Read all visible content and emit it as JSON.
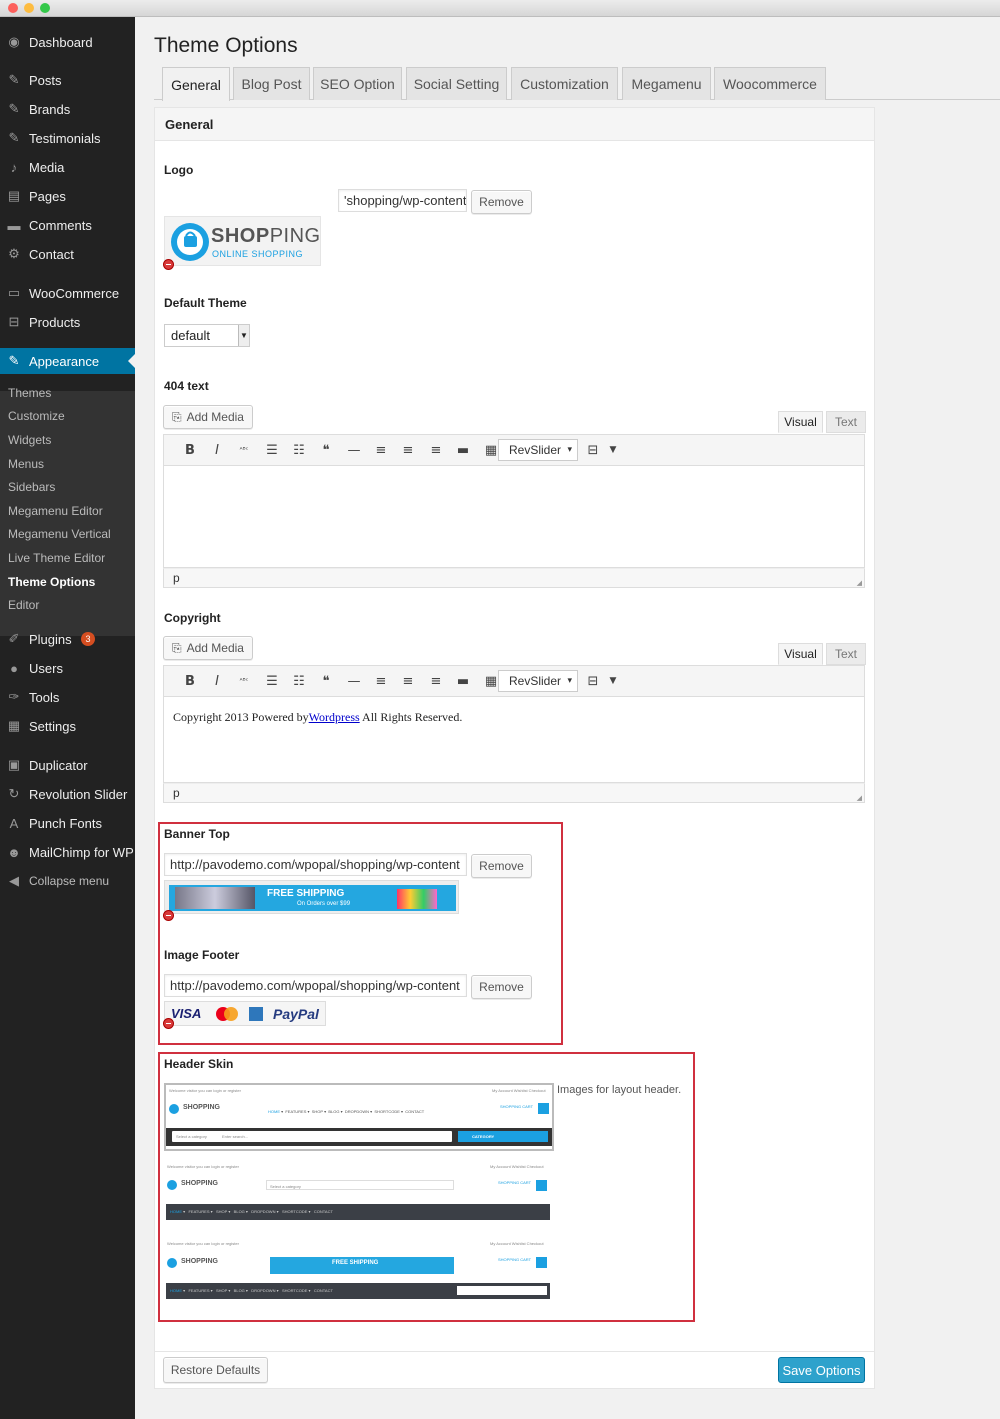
{
  "window": {
    "dot_colors": [
      "#fc605c",
      "#fdbc40",
      "#34c84a"
    ]
  },
  "sidebar": {
    "items": [
      {
        "label": "Dashboard",
        "icon": "dashboard-icon"
      },
      {
        "label": "Posts",
        "icon": "pin-icon"
      },
      {
        "label": "Brands",
        "icon": "pin-icon"
      },
      {
        "label": "Testimonials",
        "icon": "pin-icon"
      },
      {
        "label": "Media",
        "icon": "media-icon"
      },
      {
        "label": "Pages",
        "icon": "pages-icon"
      },
      {
        "label": "Comments",
        "icon": "comments-icon"
      },
      {
        "label": "Contact",
        "icon": "gear-icon"
      },
      {
        "label": "WooCommerce",
        "icon": "woo-icon"
      },
      {
        "label": "Products",
        "icon": "cart-icon"
      },
      {
        "label": "Appearance",
        "icon": "brush-icon"
      },
      {
        "label": "Plugins",
        "icon": "plug-icon",
        "badge": "3"
      },
      {
        "label": "Users",
        "icon": "user-icon"
      },
      {
        "label": "Tools",
        "icon": "wrench-icon"
      },
      {
        "label": "Settings",
        "icon": "settings-icon"
      },
      {
        "label": "Duplicator",
        "icon": "duplicator-icon"
      },
      {
        "label": "Revolution Slider",
        "icon": "refresh-icon"
      },
      {
        "label": "Punch Fonts",
        "icon": "font-icon"
      },
      {
        "label": "MailChimp for WP",
        "icon": "mailchimp-icon"
      },
      {
        "label": "Collapse menu",
        "icon": "collapse-icon"
      }
    ],
    "submenu": [
      "Themes",
      "Customize",
      "Widgets",
      "Menus",
      "Sidebars",
      "Megamenu Editor",
      "Megamenu Vertical",
      "Live Theme Editor",
      "Theme Options",
      "Editor"
    ]
  },
  "page": {
    "title": "Theme Options"
  },
  "tabs": [
    "General",
    "Blog Post",
    "SEO Option",
    "Social Setting",
    "Customization",
    "Megamenu",
    "Woocommerce"
  ],
  "panel": {
    "title": "General"
  },
  "logo": {
    "label": "Logo",
    "url": "'shopping/wp-content",
    "remove": "Remove",
    "brand_a": "SHOP",
    "brand_b": "PING",
    "tagline": "ONLINE SHOPPING"
  },
  "default_theme": {
    "label": "Default Theme",
    "value": "default"
  },
  "text404": {
    "label": "404 text",
    "add_media": "Add Media",
    "visual": "Visual",
    "text": "Text",
    "revslider": "RevSlider",
    "path": "p"
  },
  "copyright": {
    "label": "Copyright",
    "add_media": "Add Media",
    "visual": "Visual",
    "text": "Text",
    "revslider": "RevSlider",
    "content_before": "Copyright 2013 Powered by",
    "link": "Wordpress",
    "content_after": " All Rights Reserved.",
    "path": "p"
  },
  "banner_top": {
    "label": "Banner Top",
    "url": "http://pavodemo.com/wpopal/shopping/wp-content",
    "remove": "Remove",
    "headline": "FREE SHIPPING",
    "subline": "On Orders over $99"
  },
  "image_footer": {
    "label": "Image Footer",
    "url": "http://pavodemo.com/wpopal/shopping/wp-content",
    "remove": "Remove",
    "cards": [
      "VISA",
      "MasterCard",
      "AmEx",
      "PayPal"
    ]
  },
  "header_skin": {
    "label": "Header Skin",
    "description": "Images for layout header.",
    "welcome": "Welcome visitor you can login or register",
    "account": "My Account  Wishlist  Checkout",
    "nav": [
      "HOME",
      "FEATURES",
      "SHOP",
      "BLOG",
      "DROPDOWN",
      "SHORTCODE",
      "CONTACT"
    ],
    "cart": "SHOPPING CART",
    "cart_sub": "0 items - $7,024.00",
    "category": "CATEGORY",
    "select_category": "Select a category",
    "search": "Enter search..."
  },
  "footer": {
    "restore": "Restore Defaults",
    "save": "Save Options"
  }
}
